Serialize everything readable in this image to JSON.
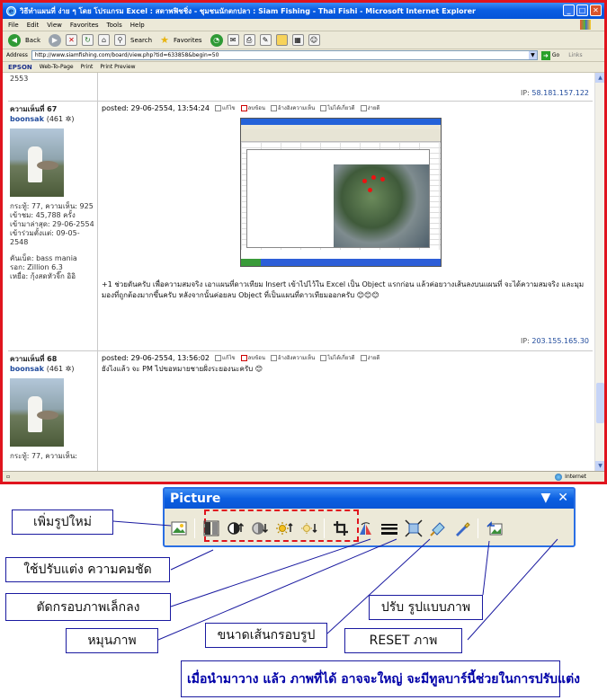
{
  "browser": {
    "title": "วิธีทำแผนที่ ง่าย ๆ โดย โปรแกรม Excel : สตาพฟิชชิ่ง - ชุมชนนักตกปลา : Siam Fishing - Thai Fishi - Microsoft Internet Explorer",
    "menu": [
      "File",
      "Edit",
      "View",
      "Favorites",
      "Tools",
      "Help"
    ],
    "toolbar": {
      "back": "Back",
      "search": "Search",
      "favorites": "Favorites"
    },
    "address_label": "Address",
    "url": "http://www.siamfishing.com/board/view.php?tid=633858&begin=50",
    "go": "Go",
    "links": "Links",
    "epson": {
      "brand": "EPSON",
      "web_to_page": "Web-To-Page",
      "print": "Print",
      "print_preview": "Print Preview"
    },
    "status_zone": "Internet"
  },
  "forum": {
    "prev_post": {
      "count": "2553",
      "ip_label": "IP:",
      "ip": "58.181.157.122"
    },
    "posts": [
      {
        "number": "ความเห็นที่ 67",
        "user": "boonsak",
        "points": "(461 ✲)",
        "stats": [
          "กระทู้: 77, ความเห็น: 925",
          "เข้าชม: 45,788 ครั้ง",
          "เข้ามาล่าสุด: 29-06-2554",
          "เข้าร่วมตั้งแต่: 09-05-2548"
        ],
        "extra": [
          "คันเบ็ด: bass mania",
          "รอก: Zillion 6.3",
          "เหยื่อ: กุ้งสดหัวจิ๊ก อิอิ"
        ],
        "posted": "posted: 29-06-2554, 13:54:24",
        "actions": [
          "แก้ไข",
          "ลบข้อน",
          "อ้างอิงความเห็น",
          "ไม่ได้เกี่ยวดี",
          "ง่ายดี"
        ],
        "text": "+1 ช่วยดันครับ เพื่อความสมจริง เอาแผนที่ดาวเทียม Insert เข้าไปไว้ใน Excel เป็น Object แรกก่อน แล้วค่อยวางเส้นลงบนแผนที่ จะได้ความสมจริง และมุมมองที่ถูกต้องมากขึ้นครับ หลังจากนั้นค่อยลบ Object ที่เป็นแผนที่ดาวเทียมออกครับ 😊😊😊",
        "ip_label": "IP:",
        "ip": "203.155.165.30"
      },
      {
        "number": "ความเห็นที่ 68",
        "user": "boonsak",
        "points": "(461 ✲)",
        "stats": [
          "กระทู้: 77, ความเห็น:"
        ],
        "posted": "posted: 29-06-2554, 13:56:02",
        "actions": [
          "แก้ไข",
          "ลบข้อน",
          "อ้างอิงความเห็น",
          "ไม่ได้เกี่ยวดี",
          "ง่ายดี"
        ],
        "text": "ยังไงแล้ว จะ PM ไปขอหมายชายฝั่งระยองนะครับ 😊"
      }
    ]
  },
  "picture_toolbar": {
    "title": "Picture",
    "tools": [
      "insert-picture",
      "color",
      "more-contrast",
      "less-contrast",
      "more-brightness",
      "less-brightness",
      "crop",
      "rotate-left",
      "line-style",
      "compress-pictures",
      "format-picture",
      "set-transparent-color",
      "reset-picture"
    ]
  },
  "callouts": {
    "insert": "เพิ่มรูปใหม่",
    "contrast": "ใช้ปรับแต่ง ความคมชัด",
    "crop": "ตัดกรอบภาพเล็กลง",
    "rotate": "หมุนภาพ",
    "line": "ขนาดเส้นกรอบรูป",
    "format": "ปรับ รูปแบบภาพ",
    "reset": "RESET ภาพ"
  },
  "note": "เมื่อนำมาวาง แล้ว ภาพที่ได้ อาจจะใหญ่ จะมีทูลบาร์นี้ช่วยในการปรับแต่ง",
  "colors": {
    "accent_red": "#e0141e",
    "xp_blue": "#0a5ee3",
    "note_blue": "#0000a8"
  }
}
